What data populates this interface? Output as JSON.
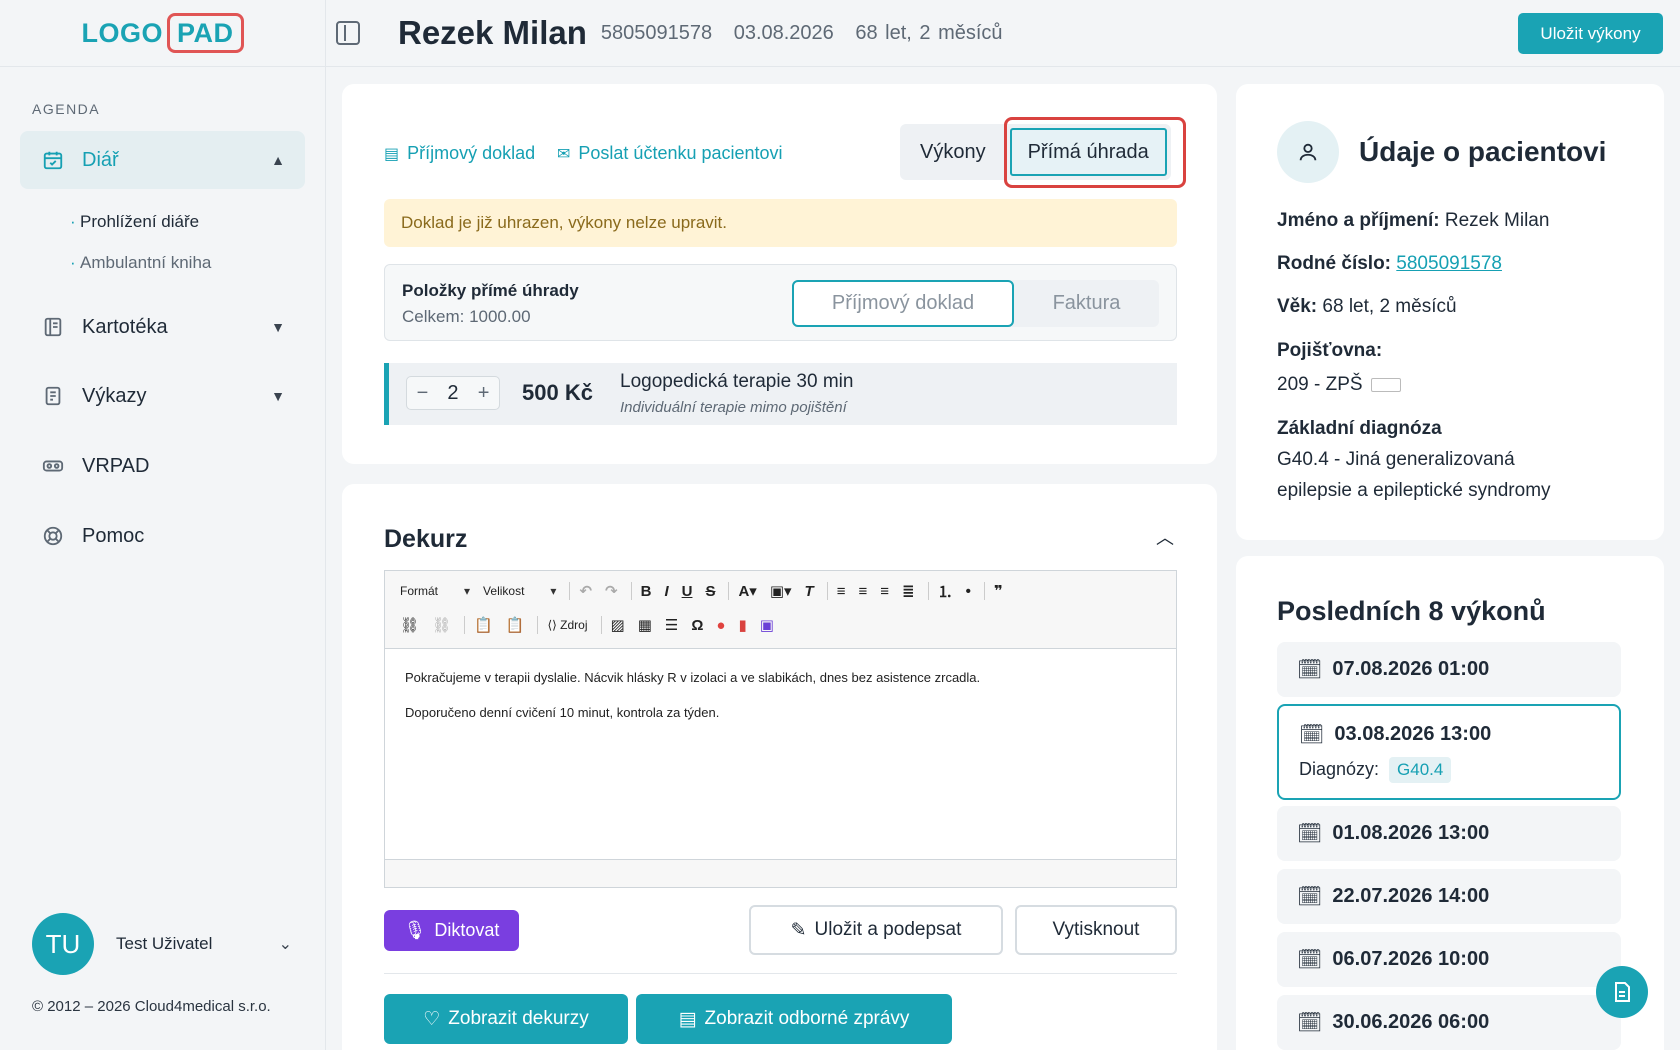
{
  "logo": {
    "left": "LOGO",
    "right": "PAD"
  },
  "sidebar": {
    "section_label": "AGENDA",
    "items": [
      {
        "label": "Diář",
        "icon": "calendar-icon"
      },
      {
        "label": "Kartotéka",
        "icon": "cards-icon"
      },
      {
        "label": "Výkazy",
        "icon": "report-icon"
      },
      {
        "label": "VRPAD",
        "icon": "vr-icon"
      },
      {
        "label": "Pomoc",
        "icon": "lifebuoy-icon"
      }
    ],
    "subitems": [
      "Prohlížení diáře",
      "Ambulantní kniha"
    ],
    "user": {
      "initials": "TU",
      "name": "Test Uživatel"
    },
    "copyright": "© 2012 – 2026 Cloud4medical s.r.o."
  },
  "header": {
    "patient_name": "Rezek Milan",
    "birth_number": "5805091578",
    "date": "03.08.2026",
    "age": "68 let, 2 měsíců",
    "save_label": "Uložit výkony"
  },
  "payment": {
    "link_receipt": "Příjmový doklad",
    "link_send": "Poslat účtenku pacientovi",
    "tab_performances": "Výkony",
    "tab_direct": "Přímá úhrada",
    "alert": "Doklad je již uhrazen, výkony nelze upravit.",
    "items_title": "Položky přímé úhrady",
    "items_total": "Celkem: 1000.00",
    "doc_receipt": "Příjmový doklad",
    "doc_invoice": "Faktura",
    "line": {
      "qty": "2",
      "price": "500 Kč",
      "name": "Logopedická terapie 30 min",
      "sub": "Individuální terapie mimo pojištění"
    }
  },
  "dekurz": {
    "title": "Dekurz",
    "format_label": "Formát",
    "size_label": "Velikost",
    "source_label": "Zdroj",
    "para1": "Pokračujeme v terapii dyslalie. Nácvik hlásky R v izolaci a ve slabikách, dnes bez asistence zrcadla.",
    "para2": "Doporučeno denní cvičení 10 minut, kontrola za týden.",
    "dictate": "Diktovat",
    "save_sign": "Uložit a podepsat",
    "print": "Vytisknout",
    "show_dek": "Zobrazit dekurzy",
    "show_reports": "Zobrazit odborné zprávy"
  },
  "patient_info": {
    "title": "Údaje o pacientovi",
    "name_label": "Jméno a příjmení:",
    "name_value": "Rezek Milan",
    "rc_label": "Rodné číslo:",
    "rc_value": "5805091578",
    "age_label": "Věk:",
    "age_value": "68 let, 2 měsíců",
    "insurance_label": "Pojišťovna:",
    "insurance_value": "209 - ZPŠ",
    "diagnosis_label": "Základní diagnóza",
    "diagnosis_line1": "G40.4 - Jiná generalizovaná",
    "diagnosis_line2": "epilepsie a epileptické syndromy"
  },
  "last_visits": {
    "title": "Posledních 8 výkonů",
    "visits": [
      {
        "date": "07.08.2026 01:00"
      },
      {
        "date": "03.08.2026 13:00",
        "diag_label": "Diagnózy:",
        "diag": "G40.4"
      },
      {
        "date": "01.08.2026 13:00"
      },
      {
        "date": "22.07.2026 14:00"
      },
      {
        "date": "06.07.2026 10:00"
      },
      {
        "date": "30.06.2026 06:00"
      }
    ]
  },
  "colors": {
    "accent": "#1aa3b4",
    "dictate": "#7a3ee0",
    "alert_bg": "#fff3d6",
    "highlight": "#d9423f"
  }
}
